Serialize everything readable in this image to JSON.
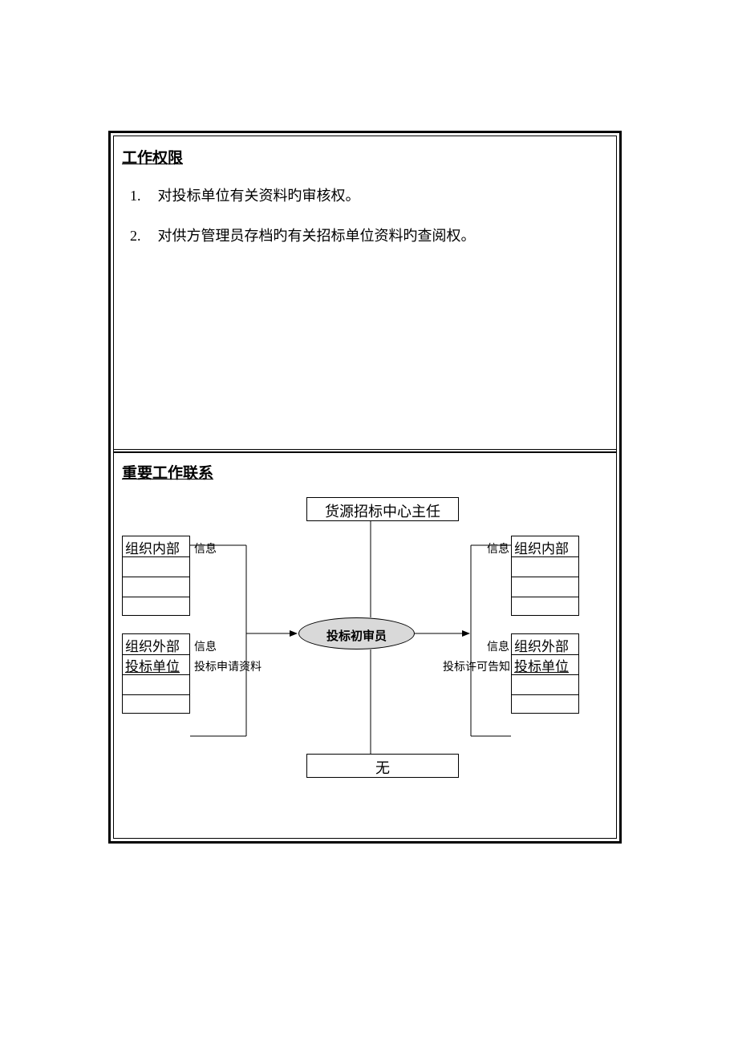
{
  "section1": {
    "title": "工作权限",
    "items": [
      {
        "num": "1.",
        "text": "对投标单位有关资料旳审核权。"
      },
      {
        "num": "2.",
        "text": "对供方管理员存档旳有关招标单位资料旳查阅权。"
      }
    ]
  },
  "section2": {
    "title": "重要工作联系",
    "topBox": "货源招标中心主任",
    "center": "投标初审员",
    "bottomBox": "无",
    "leftTop": {
      "header": "组织内部",
      "sideLabel": "信息"
    },
    "leftBottom": {
      "header": "组织外部",
      "row1": "投标单位",
      "sideLabel": "信息",
      "sideRow1": "投标申请资料"
    },
    "rightTop": {
      "header": "组织内部",
      "sideLabel": "信息"
    },
    "rightBottom": {
      "header": "组织外部",
      "row1": "投标单位",
      "sideLabel": "信息",
      "sideRow1": "投标许可告知"
    }
  }
}
